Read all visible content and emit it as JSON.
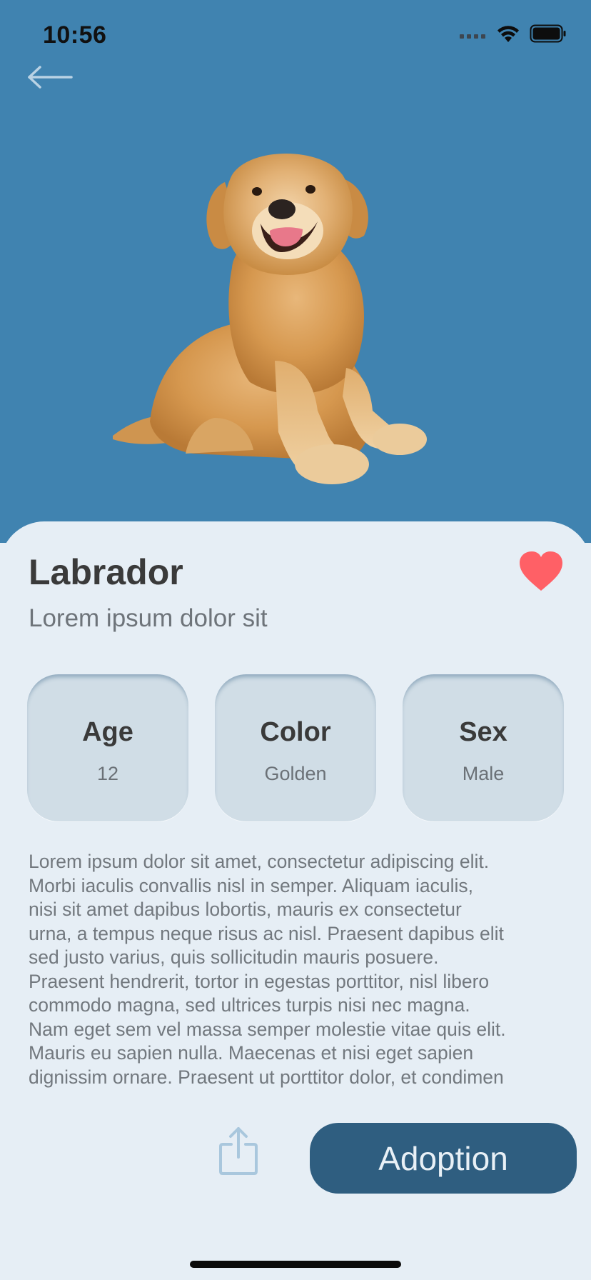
{
  "status_bar": {
    "time": "10:56"
  },
  "pet": {
    "name": "Labrador",
    "tagline": "Lorem ipsum dolor sit",
    "favorited": true,
    "stats": [
      {
        "label": "Age",
        "value": "12"
      },
      {
        "label": "Color",
        "value": "Golden"
      },
      {
        "label": "Sex",
        "value": "Male"
      }
    ],
    "description_lines": [
      "Lorem ipsum dolor sit amet, consectetur adipiscing elit.",
      "Morbi iaculis convallis nisl in semper. Aliquam iaculis,",
      "nisi sit amet dapibus lobortis, mauris ex consectetur",
      "urna, a tempus neque risus ac nisl. Praesent dapibus elit",
      "sed justo varius, quis sollicitudin mauris posuere.",
      "Praesent hendrerit, tortor in egestas porttitor, nisl libero",
      "commodo magna, sed ultrices turpis nisi nec magna.",
      "Nam eget sem vel massa semper molestie vitae quis elit.",
      "Mauris eu sapien nulla. Maecenas et nisi eget sapien",
      "dignissim ornare. Praesent ut porttitor dolor, et condimen"
    ]
  },
  "actions": {
    "adopt_label": "Adoption"
  },
  "icons": {
    "back": "arrow-left-icon",
    "favorite": "heart-icon",
    "share": "share-icon",
    "signal": "cellular-signal-icon",
    "wifi": "wifi-icon",
    "battery": "battery-icon"
  },
  "colors": {
    "hero_background": "#4083B0",
    "sheet_background": "#E6EEF5",
    "card_background": "#D0DDE6",
    "accent_button": "#2F5E80",
    "heart": "#FF6066"
  }
}
